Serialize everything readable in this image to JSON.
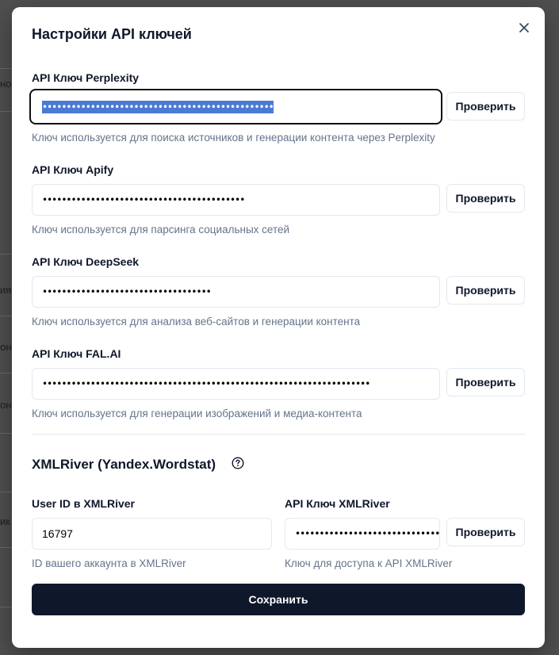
{
  "background": {
    "fragments": [
      "нов",
      "ия",
      "он",
      "он",
      "ик"
    ]
  },
  "modal": {
    "title": "Настройки API ключей",
    "close_icon": "close-icon",
    "fields": [
      {
        "label": "API Ключ Perplexity",
        "value": "••••••••••••••••••••••••••••••••••••••••••••••••",
        "hint": "Ключ используется для поиска источников и генерации контента через Perplexity",
        "button": "Проверить",
        "focused": true,
        "selected": true
      },
      {
        "label": "API Ключ Apify",
        "value": "••••••••••••••••••••••••••••••••••••••••••",
        "hint": "Ключ используется для парсинга социальных сетей",
        "button": "Проверить"
      },
      {
        "label": "API Ключ DeepSeek",
        "value": "•••••••••••••••••••••••••••••••••••",
        "hint": "Ключ используется для анализа веб-сайтов и генерации контента",
        "button": "Проверить"
      },
      {
        "label": "API Ключ FAL.AI",
        "value": "••••••••••••••••••••••••••••••••••••••••••••••••••••••••••••••••••••",
        "hint": "Ключ используется для генерации изображений и медиа-контента",
        "button": "Проверить"
      }
    ],
    "xmlriver": {
      "title": "XMLRiver (Yandex.Wordstat)",
      "help_icon": "help-circle-icon",
      "user_id": {
        "label": "User ID в XMLRiver",
        "value": "16797",
        "hint": "ID вашего аккаунта в XMLRiver"
      },
      "api_key": {
        "label": "API Ключ XMLRiver",
        "value": "••••••••••••••••••••••••••••••••",
        "hint": "Ключ для доступа к API XMLRiver",
        "button": "Проверить"
      }
    },
    "save_label": "Сохранить"
  }
}
